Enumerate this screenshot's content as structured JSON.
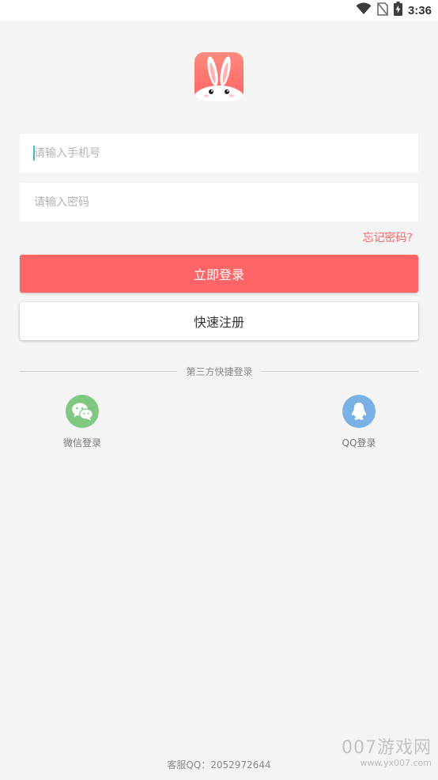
{
  "status_bar": {
    "time": "3:36",
    "icons": [
      "wifi-icon",
      "no-sim-icon",
      "battery-charging-icon"
    ]
  },
  "login_form": {
    "phone_placeholder": "请输入手机号",
    "phone_value": "",
    "password_placeholder": "请输入密码",
    "password_value": "",
    "forgot_password": "忘记密码?"
  },
  "buttons": {
    "login": "立即登录",
    "register": "快速注册"
  },
  "third_party": {
    "title": "第三方快捷登录",
    "wechat_label": "微信登录",
    "qq_label": "QQ登录"
  },
  "footer": {
    "customer_service": "客服QQ：2052972644"
  },
  "watermark": {
    "brand": "007游戏网",
    "url": "www.yx007.com"
  },
  "colors": {
    "accent": "#ff6567",
    "background": "#f4f4f4",
    "wechat": "#7fc882",
    "qq": "#79b0e5"
  }
}
